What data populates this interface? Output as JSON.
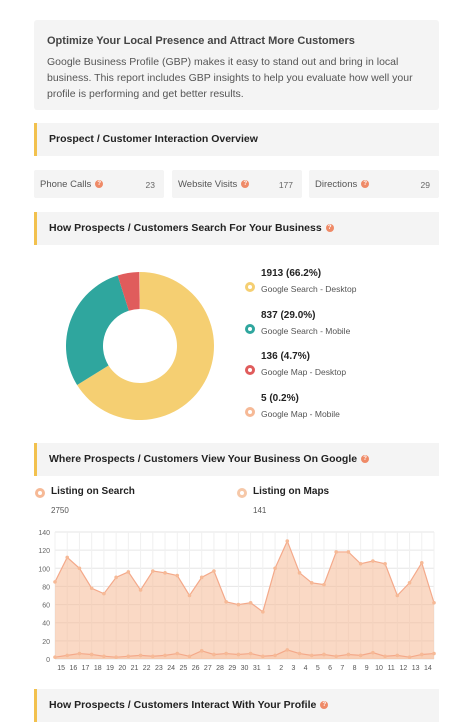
{
  "intro": {
    "title": "Optimize Your Local Presence and Attract More Customers",
    "text": "Google Business Profile (GBP) makes it easy to stand out and bring in local business. This report includes GBP insights to help you evaluate how well your profile is performing and get better results."
  },
  "sections": {
    "interaction": "Prospect / Customer Interaction Overview",
    "search": "How Prospects / Customers Search For Your Business",
    "view": "Where Prospects / Customers View Your Business On Google",
    "interact": "How Prospects / Customers Interact With Your Profile"
  },
  "metrics": [
    {
      "label": "Phone Calls",
      "value": "23"
    },
    {
      "label": "Website Visits",
      "value": "177"
    },
    {
      "label": "Directions",
      "value": "29"
    }
  ],
  "search_legend": [
    {
      "value": "1913 (66.2%)",
      "label": "Google Search - Desktop",
      "color": "#f5cf72"
    },
    {
      "value": "837 (29.0%)",
      "label": "Google Search - Mobile",
      "color": "#2fa69e"
    },
    {
      "value": "136 (4.7%)",
      "label": "Google Map - Desktop",
      "color": "#e05c5c"
    },
    {
      "value": "5 (0.2%)",
      "label": "Google Map - Mobile",
      "color": "#f6b996"
    }
  ],
  "view_legend": [
    {
      "label": "Listing on Search",
      "value": "2750",
      "color": "#f6b996"
    },
    {
      "label": "Listing on Maps",
      "value": "141",
      "color": "#f6c8a8"
    }
  ],
  "chart_data": [
    {
      "type": "pie",
      "title": "",
      "categories": [
        "Google Search - Desktop",
        "Google Search - Mobile",
        "Google Map - Desktop",
        "Google Map - Mobile"
      ],
      "values": [
        1913,
        837,
        136,
        5
      ],
      "colors": [
        "#f5cf72",
        "#2fa69e",
        "#e05c5c",
        "#f6b996"
      ]
    },
    {
      "type": "area",
      "title": "",
      "x": [
        "15",
        "16",
        "17",
        "18",
        "19",
        "20",
        "21",
        "22",
        "23",
        "24",
        "25",
        "26",
        "27",
        "28",
        "29",
        "30",
        "31",
        "1",
        "2",
        "3",
        "4",
        "5",
        "6",
        "7",
        "8",
        "9",
        "10",
        "11",
        "12",
        "13",
        "14"
      ],
      "ylim": [
        0,
        140
      ],
      "yticks": [
        0,
        20,
        40,
        60,
        80,
        100,
        120,
        140
      ],
      "series": [
        {
          "name": "Listing on Search",
          "values": [
            85,
            112,
            100,
            78,
            72,
            90,
            96,
            76,
            97,
            95,
            92,
            70,
            90,
            97,
            63,
            60,
            62,
            52,
            100,
            130,
            95,
            84,
            82,
            118,
            118,
            105,
            108,
            105,
            70,
            84,
            106,
            62
          ],
          "color": "#f6b996"
        },
        {
          "name": "Listing on Maps",
          "values": [
            2,
            4,
            6,
            5,
            3,
            2,
            3,
            4,
            3,
            4,
            6,
            3,
            9,
            5,
            6,
            5,
            6,
            3,
            4,
            10,
            6,
            4,
            5,
            3,
            5,
            4,
            7,
            3,
            4,
            2,
            5,
            6
          ],
          "color": "#f6b996"
        }
      ]
    }
  ]
}
